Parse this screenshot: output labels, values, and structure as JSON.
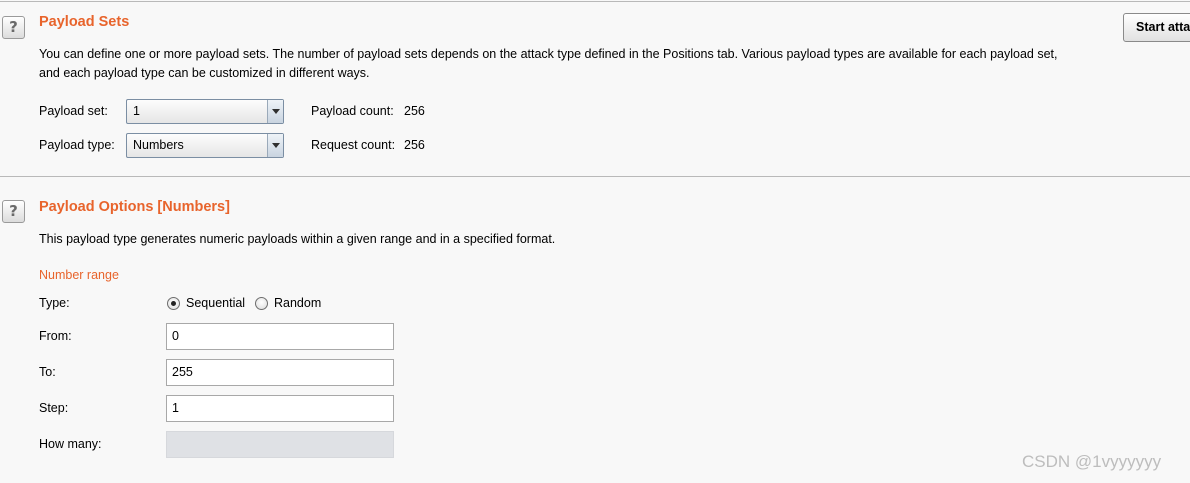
{
  "payload_sets": {
    "title": "Payload Sets",
    "description_line1": "You can define one or more payload sets. The number of payload sets depends on the attack type defined in the Positions tab. Various payload types are available for each payload set,",
    "description_line2": "and each payload type can be customized in different ways.",
    "payload_set_label": "Payload set:",
    "payload_set_value": "1",
    "payload_type_label": "Payload type:",
    "payload_type_value": "Numbers",
    "payload_count_label": "Payload count:",
    "payload_count_value": "256",
    "request_count_label": "Request count:",
    "request_count_value": "256",
    "start_button_label": "Start atta"
  },
  "payload_options": {
    "title": "Payload Options [Numbers]",
    "description": "This payload type generates numeric payloads within a given range and in a specified format.",
    "number_range_heading": "Number range",
    "type_label": "Type:",
    "type_options": [
      "Sequential",
      "Random"
    ],
    "type_selected": "Sequential",
    "from_label": "From:",
    "from_value": "0",
    "to_label": "To:",
    "to_value": "255",
    "step_label": "Step:",
    "step_value": "1",
    "how_many_label": "How many:",
    "how_many_value": ""
  },
  "help_icon_glyph": "?",
  "watermark": "CSDN @1vyyyyyy",
  "colors": {
    "accent": "#e8642c",
    "background": "#f8f8f8"
  }
}
